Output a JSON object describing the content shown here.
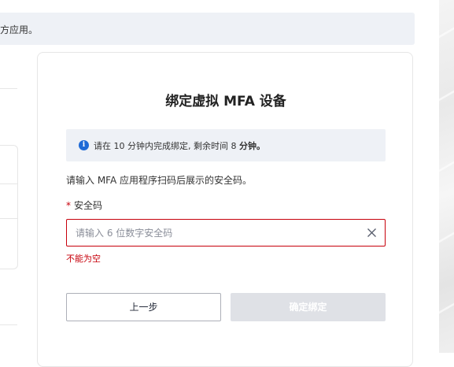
{
  "banner": {
    "text": "方应用。"
  },
  "dialog": {
    "title": "绑定虚拟 MFA 设备",
    "notice": {
      "icon": "info-icon",
      "prefix": "请在 10 分钟内完成绑定, 剩余时间 8 ",
      "emphasis": "分钟。"
    },
    "description": "请输入 MFA 应用程序扫码后展示的安全码。",
    "field": {
      "required_mark": "*",
      "label": "安全码",
      "value": "",
      "placeholder": "请输入 6 位数字安全码",
      "clear_icon": "close-icon",
      "error": "不能为空"
    },
    "buttons": {
      "prev": "上一步",
      "confirm": "确定绑定"
    }
  },
  "colors": {
    "error": "#c7000b",
    "info": "#1f6ad6",
    "disabled_button": "#dfe1e6",
    "notice_bg": "#eef1f6"
  }
}
